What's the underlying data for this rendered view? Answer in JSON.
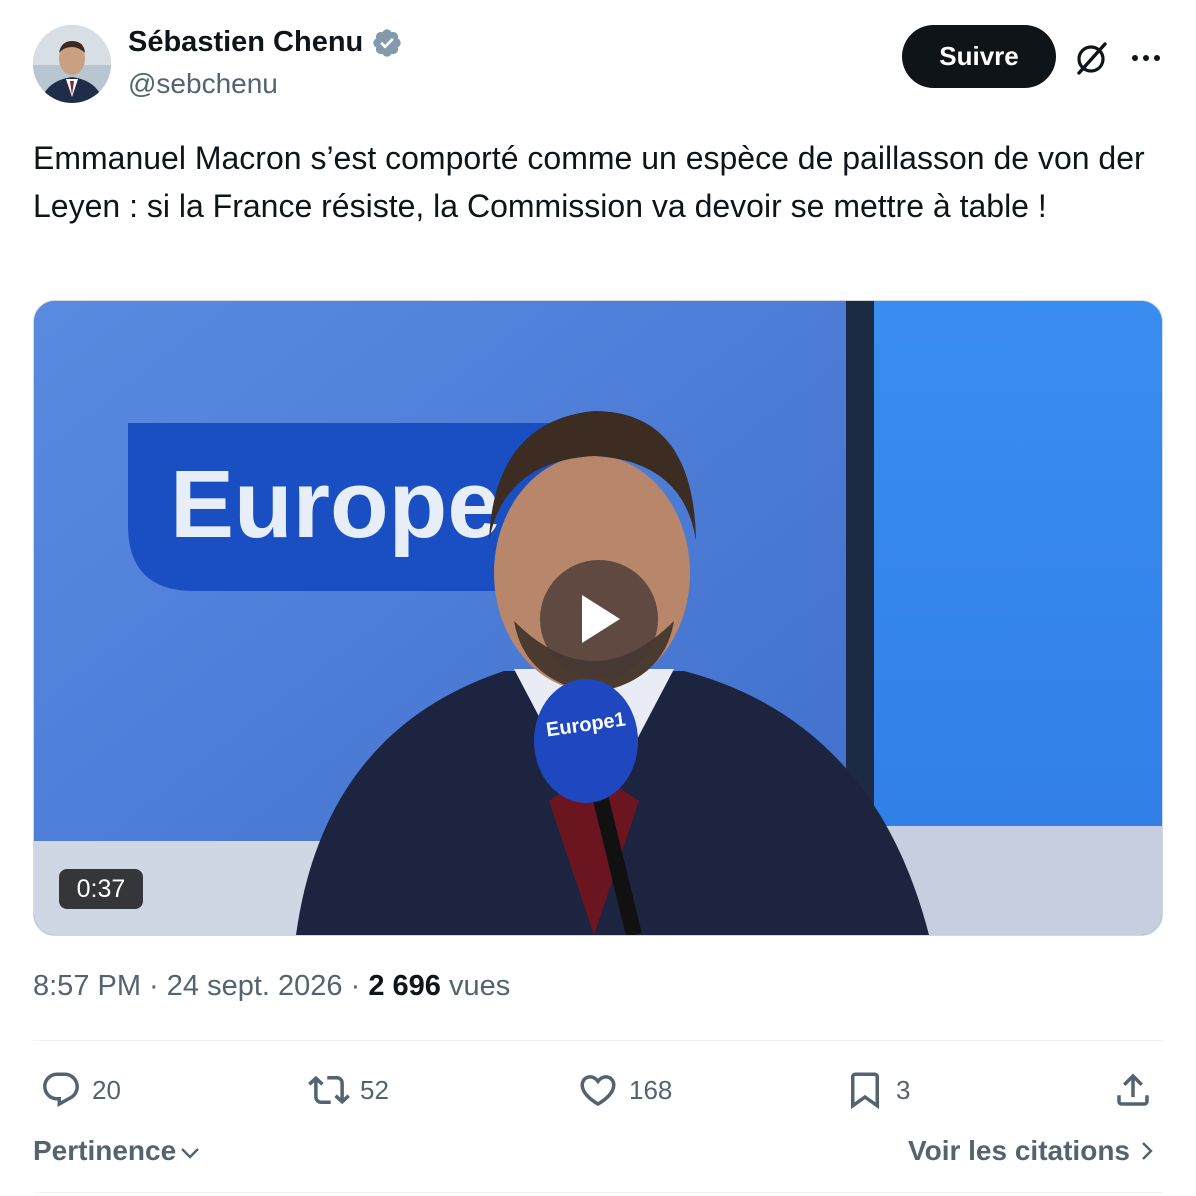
{
  "author": {
    "display_name": "Sébastien Chenu",
    "handle": "@sebchenu",
    "verified": true
  },
  "header": {
    "follow_label": "Suivre",
    "grok_icon": "grok-icon",
    "more_icon": "more-icon"
  },
  "tweet": {
    "text": "Emmanuel Macron s’est comporté comme un espèce de paillasson de von der Leyen : si la France résiste, la Commission va devoir se mettre à table !"
  },
  "media": {
    "duration": "0:37",
    "backdrop_logo_text": "Europe 1",
    "mic_logo_text": "Europe1",
    "play_icon": "play-icon"
  },
  "meta": {
    "time": "8:57 PM",
    "separator": " · ",
    "date": "24 sept. 2026",
    "views_count": "2 696",
    "views_label": "vues"
  },
  "actions": {
    "replies": "20",
    "reposts": "52",
    "likes": "168",
    "bookmarks": "3"
  },
  "footer": {
    "sort_label": "Pertinence",
    "quotes_label": "Voir les citations"
  },
  "colors": {
    "text_primary": "#0f1419",
    "text_secondary": "#536471",
    "verified_badge": "#829aab",
    "button_bg": "#0f1419",
    "europe1_blue": "#1a4fc4"
  }
}
